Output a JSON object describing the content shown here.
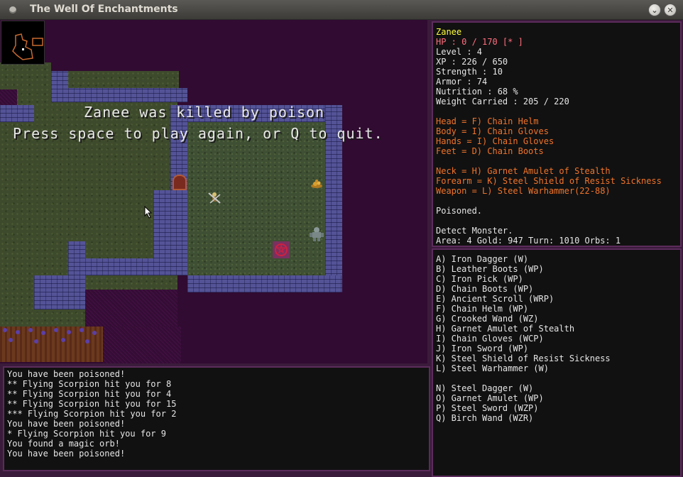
{
  "window": {
    "title": "The Well Of Enchantments",
    "minimize_glyph": "⌄",
    "close_glyph": "✕"
  },
  "colors": {
    "name": "#ffff3a",
    "hp": "#ff6f7f",
    "stat": "#e6e6e6",
    "equipment": "#f0742a",
    "frame": "#5b2c5b",
    "wall": "#545397",
    "floor": "#3e4f33"
  },
  "overlay": {
    "death_message": "Zanee was killed by poison",
    "prompt": "Press space to play again, or Q to quit."
  },
  "stats": {
    "name": "Zanee",
    "hp": "HP : 0 / 170 [*          ]",
    "level": "Level : 4",
    "xp": "XP : 226 / 650",
    "strength": "Strength : 10",
    "armor": "Armor : 74",
    "nutrition": "Nutrition : 68 %",
    "weight": "Weight Carried : 205 / 220",
    "equipment": [
      "Head = F) Chain Helm",
      "Body = I) Chain Gloves",
      "Hands = I) Chain Gloves",
      "Feet = D) Chain Boots"
    ],
    "accessories": [
      "Neck = H) Garnet Amulet of Stealth",
      "Forearm = K) Steel Shield of Resist Sickness",
      "Weapon = L) Steel Warhammer(22-88)"
    ],
    "status_1": "Poisoned.",
    "status_2": "Detect Monster.",
    "footer": "Area: 4  Gold: 947  Turn: 1010   Orbs: 1"
  },
  "inventory": [
    "A) Iron Dagger  (W)",
    "B) Leather Boots  (WP)",
    "C) Iron Pick  (WP)",
    "D) Chain Boots  (WP)",
    "E) Ancient Scroll  (WRP)",
    "F) Chain Helm  (WP)",
    "G) Crooked Wand  (WZ)",
    "H) Garnet Amulet of Stealth",
    "I) Chain Gloves  (WCP)",
    "J) Iron Sword  (WP)",
    "K) Steel Shield of Resist Sickness",
    "L) Steel Warhammer  (W)",
    "",
    "N) Steel Dagger  (W)",
    "O) Garnet Amulet  (WP)",
    "P) Steel Sword  (WZP)",
    "Q) Birch Wand  (WZR)"
  ],
  "log": [
    "You have been poisoned!",
    "** Flying Scorpion hit you for 8",
    "** Flying Scorpion hit you for 4",
    "** Flying Scorpion hit you for 15",
    "*** Flying Scorpion hit you for 2",
    "You have been poisoned!",
    "* Flying Scorpion hit you for 9",
    "You found a magic orb!",
    "You have been poisoned!"
  ]
}
